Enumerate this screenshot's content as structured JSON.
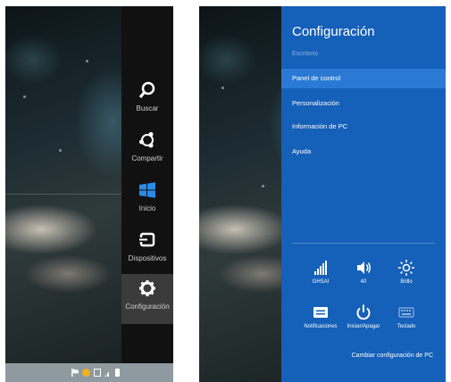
{
  "left_screen": {
    "charms": [
      {
        "label": "Buscar",
        "icon": "search-icon"
      },
      {
        "label": "Compartir",
        "icon": "share-icon"
      },
      {
        "label": "Inicio",
        "icon": "windows-logo-icon"
      },
      {
        "label": "Dispositivos",
        "icon": "devices-icon"
      },
      {
        "label": "Configuración",
        "icon": "gear-icon"
      }
    ],
    "active_charm": "Configuración"
  },
  "settings": {
    "title": "Configuración",
    "subtitle": "Escritorio",
    "items": [
      {
        "label": "Panel de control",
        "selected": true
      },
      {
        "label": "Personalización",
        "selected": false
      },
      {
        "label": "Información de PC",
        "selected": false
      },
      {
        "label": "Ayuda",
        "selected": false
      }
    ],
    "quick_settings": [
      {
        "label": "GHSAI",
        "icon": "network-signal-icon"
      },
      {
        "label": "40",
        "icon": "volume-icon"
      },
      {
        "label": "Brillo",
        "icon": "brightness-icon"
      },
      {
        "label": "Notificaciones",
        "icon": "notifications-icon"
      },
      {
        "label": "Iniciar/Apagar",
        "icon": "power-icon"
      },
      {
        "label": "Teclado",
        "icon": "keyboard-icon"
      }
    ],
    "change_pc_settings": "Cambiar configuración de PC",
    "accent_color": "#1560b8",
    "selected_color": "#2a7ad4"
  }
}
